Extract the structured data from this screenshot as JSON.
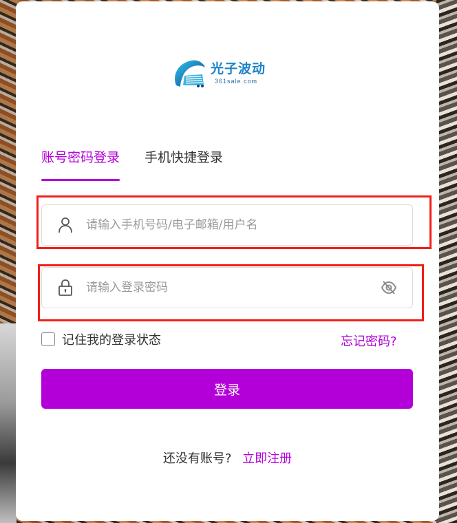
{
  "brand": {
    "name_cn": "光子波动",
    "domain": "361sale.com",
    "colors": {
      "primary": "#b300d8",
      "logo_blue": "#1d83c9",
      "highlight": "#f41e16"
    }
  },
  "tabs": [
    {
      "label": "账号密码登录",
      "active": true
    },
    {
      "label": "手机快捷登录",
      "active": false
    }
  ],
  "form": {
    "username": {
      "value": "",
      "placeholder": "请输入手机号码/电子邮箱/用户名",
      "icon": "user-icon"
    },
    "password": {
      "value": "",
      "placeholder": "请输入登录密码",
      "icon": "lock-icon",
      "toggle_icon": "eye-off-icon"
    },
    "remember_label": "记住我的登录状态",
    "remember_checked": false,
    "forgot_link": "忘记密码?",
    "submit_label": "登录"
  },
  "register": {
    "question": "还没有账号?",
    "link": "立即注册"
  }
}
